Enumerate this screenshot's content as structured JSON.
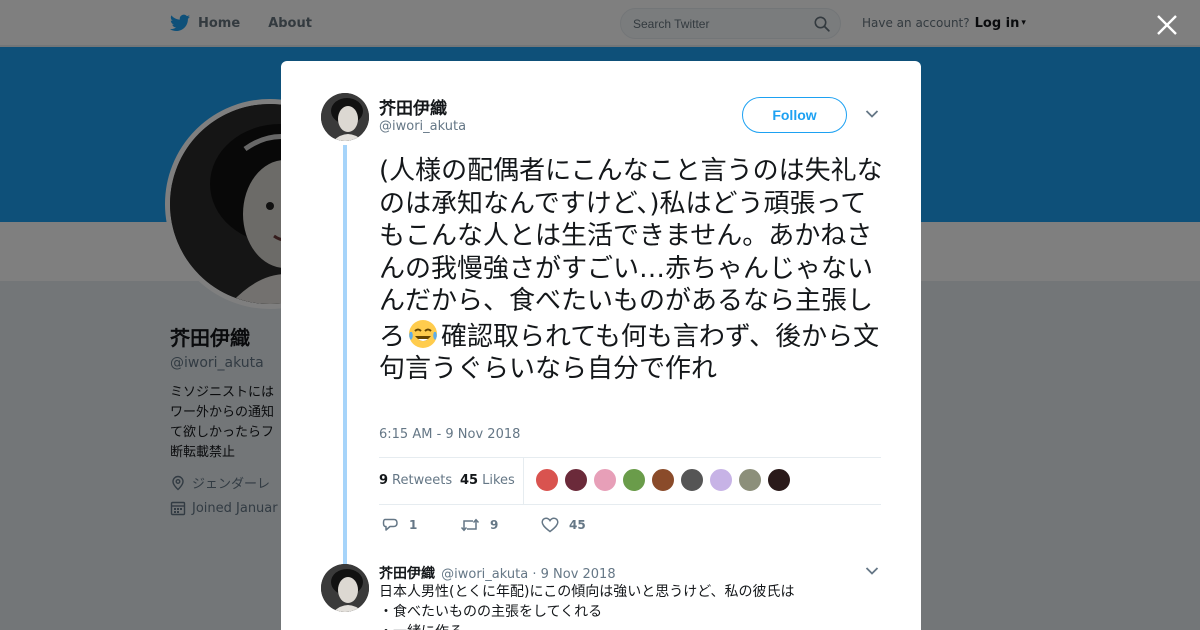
{
  "nav": {
    "home_label": "Home",
    "about_label": "About"
  },
  "search": {
    "placeholder": "Search Twitter"
  },
  "account": {
    "prompt": "Have an account?",
    "login_label": "Log in"
  },
  "profile": {
    "name": "芥田伊織",
    "handle": "@iwori_akuta",
    "bio_lines": [
      "ミソジニストには",
      "ワー外からの通知",
      "て欲しかったらフ",
      "断転載禁止"
    ],
    "location": "ジェンダーレ",
    "joined": "Joined Januar"
  },
  "tweet": {
    "author_name": "芥田伊織",
    "author_handle": "@iwori_akuta",
    "follow_label": "Follow",
    "text_before_emoji": "(人様の配偶者にこんなこと言うのは失礼なのは承知なんですけど、)私はどう頑張ってもこんな人とは生活できません。あかねさんの我慢強さがすごい…赤ちゃんじゃないんだから、食べたいものがあるなら主張しろ",
    "emoji": "face-with-tears-of-joy",
    "text_after_emoji": "確認取られても何も言わず、後から文句言うぐらいなら自分で作れ",
    "timestamp": "6:15 AM - 9 Nov 2018",
    "retweets_count": "9",
    "retweets_label": "Retweets",
    "likes_count": "45",
    "likes_label": "Likes",
    "actions": {
      "reply_count": "1",
      "retweet_count": "9",
      "like_count": "45"
    }
  },
  "likers_colors": [
    "#d9534f",
    "#6b2a3a",
    "#e79fb8",
    "#6a9c4a",
    "#8a4b2a",
    "#555555",
    "#c7b3e6",
    "#8c8f7a",
    "#2a1a1a"
  ],
  "reply": {
    "author_name": "芥田伊織",
    "author_handle": "@iwori_akuta",
    "date": "· 9 Nov 2018",
    "lines": [
      "日本人男性(とくに年配)にこの傾向は強いと思うけど、私の彼氏は",
      "・食べたいものの主張をしてくれる",
      "・一緒に作る"
    ]
  },
  "colors": {
    "accent": "#1da1f2",
    "thread_line": "#a6d4fa"
  }
}
